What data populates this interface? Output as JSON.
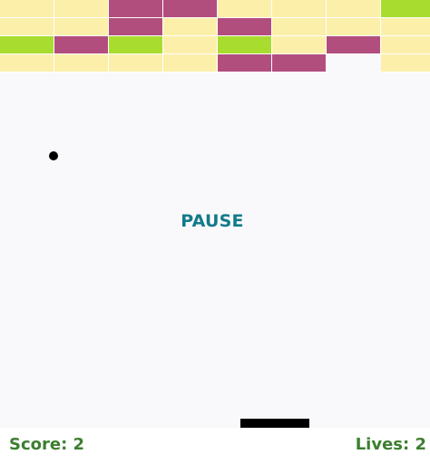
{
  "colors": {
    "yellow": "#fcefaa",
    "magenta": "#b24e7d",
    "green": "#a8dc2f",
    "pause_text": "#137a8a",
    "hud_text": "#3d7f2f",
    "paddle": "#000000",
    "ball": "#000000"
  },
  "bricks": {
    "rows": [
      [
        "yellow",
        "yellow",
        "magenta",
        "magenta",
        "yellow",
        "yellow",
        "yellow",
        "green"
      ],
      [
        "yellow",
        "yellow",
        "magenta",
        "yellow",
        "magenta",
        "yellow",
        "yellow",
        "yellow"
      ],
      [
        "green",
        "magenta",
        "green",
        "yellow",
        "green",
        "yellow",
        "magenta",
        "yellow"
      ],
      [
        "yellow",
        "yellow",
        "yellow",
        "yellow",
        "magenta",
        "magenta",
        null,
        "yellow"
      ]
    ]
  },
  "status": {
    "pause_label": "PAUSE"
  },
  "hud": {
    "score_label": "Score: 2",
    "lives_label": "Lives: 2",
    "score": 2,
    "lives": 2
  }
}
